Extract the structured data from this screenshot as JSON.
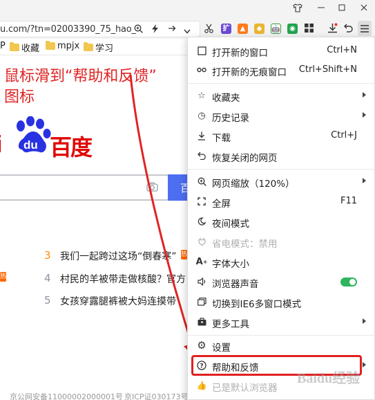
{
  "titlebar": {
    "icons": [
      "shirt-icon",
      "minimize-icon",
      "restore-icon",
      "close-icon"
    ]
  },
  "toolbar": {
    "url": "u.com/?tn=02003390_75_hao_",
    "icons": [
      "zoom-icon",
      "lightning-icon",
      "chevron-down-icon",
      "scissors-icon",
      "downloads-icon",
      "undo-icon",
      "menu-icon"
    ]
  },
  "bookmarks": {
    "items": [
      {
        "label": "P",
        "folder": false
      },
      {
        "label": "收藏",
        "folder": true
      },
      {
        "label": "mpjx",
        "folder": true
      },
      {
        "label": "学习",
        "folder": true
      }
    ]
  },
  "annotation": {
    "line1": "鼠标滑到“帮助和反馈”",
    "line2": "图标"
  },
  "logo": {
    "left": "i",
    "paw": "du",
    "right": "百度"
  },
  "search": {
    "button_label": "百"
  },
  "hot_list": [
    {
      "num": "3",
      "text": "我们一起跨过这场“倒春寒”",
      "num_color": "#ff8b00"
    },
    {
      "num": "4",
      "text": "村民的羊被带走做核酸？官方",
      "num_color": "#9195a3"
    },
    {
      "num": "5",
      "text": "女孩穿露腿裤被大妈连摸带",
      "num_color": "#9195a3"
    }
  ],
  "hot_tags": [
    "热",
    "热"
  ],
  "footer": {
    "left": "京公网安备11000002000001号",
    "right": "京ICP证030173号"
  },
  "menu": {
    "items": [
      {
        "id": "new-window",
        "icon": "□",
        "label": "打开新的窗口",
        "shortcut": "Ctrl+N"
      },
      {
        "id": "new-incognito",
        "icon": "∞",
        "label": "打开新的无痕窗口",
        "shortcut": "Ctrl+Shift+N"
      },
      {
        "id": "favorites",
        "icon": "☆",
        "label": "收藏夹",
        "submenu": true
      },
      {
        "id": "history",
        "icon": "◷",
        "label": "历史记录",
        "submenu": true
      },
      {
        "id": "download",
        "icon": "⤓",
        "label": "下载",
        "shortcut": "Ctrl+J"
      },
      {
        "id": "restore-closed",
        "icon": "↶",
        "label": "恢复关闭的网页"
      },
      {
        "id": "zoom",
        "icon": "⊕",
        "label": "网页缩放（120%）",
        "submenu": true
      },
      {
        "id": "fullscreen",
        "icon": "⛶",
        "label": "全屏",
        "shortcut": "F11"
      },
      {
        "id": "night-mode",
        "icon": "☾",
        "label": "夜间模式"
      },
      {
        "id": "power-save",
        "icon": "⚲",
        "label": "省电模式：禁用",
        "disabled": true
      },
      {
        "id": "font-size",
        "icon": "A",
        "label": "字体大小"
      },
      {
        "id": "browser-sound",
        "icon": "🔈",
        "label": "浏览器声音",
        "toggle": true
      },
      {
        "id": "ie6-mode",
        "icon": "⧉",
        "label": "切换到IE6多窗口模式"
      },
      {
        "id": "more-tools",
        "icon": "▣",
        "label": "更多工具",
        "submenu": true
      },
      {
        "id": "settings",
        "icon": "⚙",
        "label": "设置"
      },
      {
        "id": "help-feedback",
        "icon": "?",
        "label": "帮助和反馈",
        "submenu": true
      },
      {
        "id": "default-browser",
        "icon": "👍",
        "label": "已是默认浏览器",
        "disabled": true
      }
    ]
  },
  "watermark": "Baidu经验",
  "colors": {
    "annotation_red": "#e02424",
    "baidu_red": "#e10602",
    "baidu_blue": "#2932e1",
    "search_blue": "#4e6ef2",
    "toggle_green": "#2db55d"
  }
}
